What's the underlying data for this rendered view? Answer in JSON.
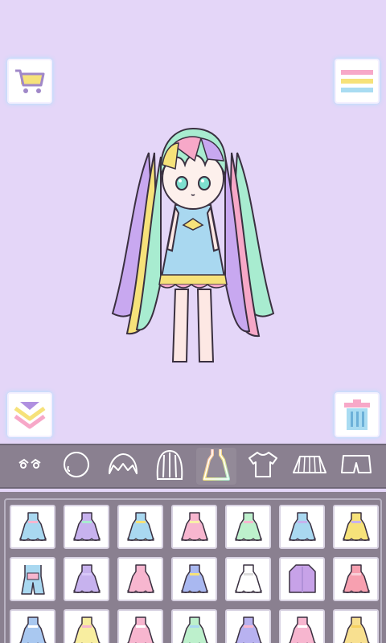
{
  "toolbar": {
    "cart_icon": "shopping-cart-icon",
    "menu_icon": "menu-icon",
    "collapse_icon": "collapse-chevrons-icon",
    "trash_icon": "trash-icon"
  },
  "categories": [
    {
      "name": "eyes",
      "icon": "eyes-icon"
    },
    {
      "name": "face",
      "icon": "face-icon"
    },
    {
      "name": "bangs",
      "icon": "bangs-icon"
    },
    {
      "name": "hair",
      "icon": "hair-icon"
    },
    {
      "name": "dress",
      "icon": "dress-icon",
      "active": true
    },
    {
      "name": "top",
      "icon": "shirt-icon"
    },
    {
      "name": "skirt",
      "icon": "skirt-icon"
    },
    {
      "name": "shorts",
      "icon": "shorts-icon"
    }
  ],
  "colors": {
    "background": "#e4d6f8",
    "panel": "#8a8090",
    "accent_yellow": "#f6e27a",
    "accent_pink": "#f7a8c8",
    "accent_blue": "#a9dcf2",
    "accent_purple": "#c8a8f0",
    "accent_mint": "#a8ecd0"
  },
  "closet_items": [
    {
      "type": "dress",
      "color": "#a9d8f0",
      "trim": "#f7b6cf"
    },
    {
      "type": "dress",
      "color": "#c7b2ee",
      "trim": "#a8ecd0"
    },
    {
      "type": "dress",
      "color": "#a9d8f0",
      "trim": "#f6e27a"
    },
    {
      "type": "dress",
      "color": "#f7b6cf",
      "trim": "#f8f0a8"
    },
    {
      "type": "dress",
      "color": "#bdf0cc",
      "trim": "#f7b6cf"
    },
    {
      "type": "dress",
      "color": "#a9d8f0",
      "trim": "#c7b2ee"
    },
    {
      "type": "dress",
      "color": "#f6e27a",
      "trim": "#c7b2ee"
    },
    {
      "type": "overalls",
      "color": "#a9d8f0",
      "trim": "#f7b6cf"
    },
    {
      "type": "dress",
      "color": "#c7b2ee",
      "trim": "#d8c8f8"
    },
    {
      "type": "dress",
      "color": "#f7b6cf",
      "trim": "#f7b6cf"
    },
    {
      "type": "dress",
      "color": "#a9b8f0",
      "trim": "#f6e27a"
    },
    {
      "type": "dress",
      "color": "#ffffff",
      "trim": "#dddddd"
    },
    {
      "type": "coat",
      "color": "#c7a2e8",
      "trim": "#b090d8"
    },
    {
      "type": "dress",
      "color": "#f7a0b0",
      "trim": "#f8d0d8"
    },
    {
      "type": "dress",
      "color": "#a9c8f0",
      "trim": "#ffffff"
    },
    {
      "type": "dress",
      "color": "#f8eea0",
      "trim": "#f7b6cf"
    },
    {
      "type": "dress",
      "color": "#f7b6cf",
      "trim": "#ffffff"
    },
    {
      "type": "dress",
      "color": "#bdf0cc",
      "trim": "#a9d8f0"
    },
    {
      "type": "dress",
      "color": "#b8b2f0",
      "trim": "#f7b6cf"
    },
    {
      "type": "dress",
      "color": "#f7b6cf",
      "trim": "#ffffff"
    },
    {
      "type": "dress",
      "color": "#f8e090",
      "trim": "#f6d060"
    }
  ]
}
